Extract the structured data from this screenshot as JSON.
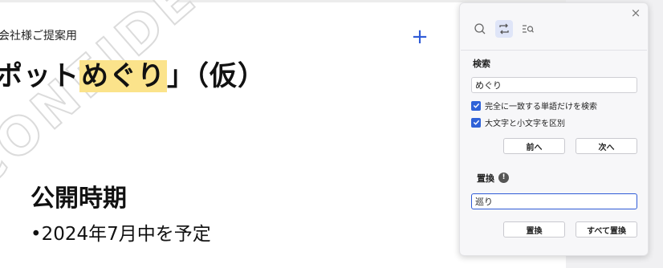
{
  "slide": {
    "subtitle": "会社様ご提案用",
    "title_prefix": "ポット",
    "title_highlight": "めぐり",
    "title_suffix": "」（仮）",
    "add_icon": "+",
    "watermark": "CONFIDENTIAL",
    "section_heading": "公開時期",
    "bullet_text": "•2024年7月中を予定"
  },
  "panel": {
    "close_icon": "×",
    "modes": [
      {
        "icon": "search-icon",
        "active": false
      },
      {
        "icon": "replace-icon",
        "active": true
      },
      {
        "icon": "find-in-list-icon",
        "active": false
      }
    ],
    "search_label": "検索",
    "search_value": "めぐり",
    "options": [
      {
        "label": "完全に一致する単語だけを検索",
        "checked": true
      },
      {
        "label": "大文字と小文字を区別",
        "checked": true
      }
    ],
    "prev_label": "前へ",
    "next_label": "次へ",
    "replace_label": "置換",
    "replace_value": "巡り",
    "replace_button": "置換",
    "replace_all_button": "すべて置換",
    "accent_color": "#2f62d8",
    "highlight_color": "#fbe38b"
  }
}
